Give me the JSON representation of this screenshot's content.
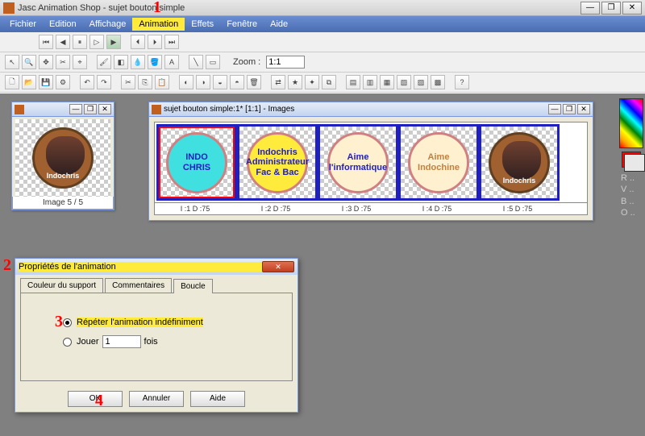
{
  "app": {
    "title": "Jasc Animation Shop - sujet bouton simple"
  },
  "winbtns": {
    "min": "—",
    "max": "❐",
    "close": "✕"
  },
  "menu": [
    "Fichier",
    "Edition",
    "Affichage",
    "Animation",
    "Effets",
    "Fenêtre",
    "Aide"
  ],
  "menu_hl_index": 3,
  "zoom": {
    "label": "Zoom :",
    "value": "1:1"
  },
  "preview": {
    "caption": "Image 5 / 5",
    "circ_text": "Indochris"
  },
  "strip": {
    "title": "sujet bouton simple:1* [1:1] - Images",
    "frames": [
      {
        "lines": [
          "INDO",
          "CHRIS"
        ],
        "label": "I :1   D :75"
      },
      {
        "lines": [
          "Indochris",
          "Administrateur",
          "Fac & Bac"
        ],
        "label": "I :2   D :75"
      },
      {
        "lines": [
          "Aime",
          "l'informatique"
        ],
        "label": "I :3   D :75"
      },
      {
        "lines": [
          "Aime",
          "Indochine"
        ],
        "label": "I :4   D :75"
      },
      {
        "lines": [
          "Indochris"
        ],
        "label": "I :5   D :75"
      }
    ]
  },
  "side": {
    "r": "R ..",
    "v": "V ..",
    "b": "B ..",
    "o": "O .."
  },
  "dialog": {
    "title": "Propriétés de l'animation",
    "tabs": [
      "Couleur du support",
      "Commentaires",
      "Boucle"
    ],
    "active_tab": 2,
    "opt_repeat": "Répéter l'animation indéfiniment",
    "opt_play": "Jouer",
    "play_count": "1",
    "play_suffix": "fois",
    "btn_ok": "OK",
    "btn_cancel": "Annuler",
    "btn_help": "Aide"
  },
  "annot": {
    "a1": "1",
    "a2": "2",
    "a3": "3",
    "a4": "4"
  }
}
